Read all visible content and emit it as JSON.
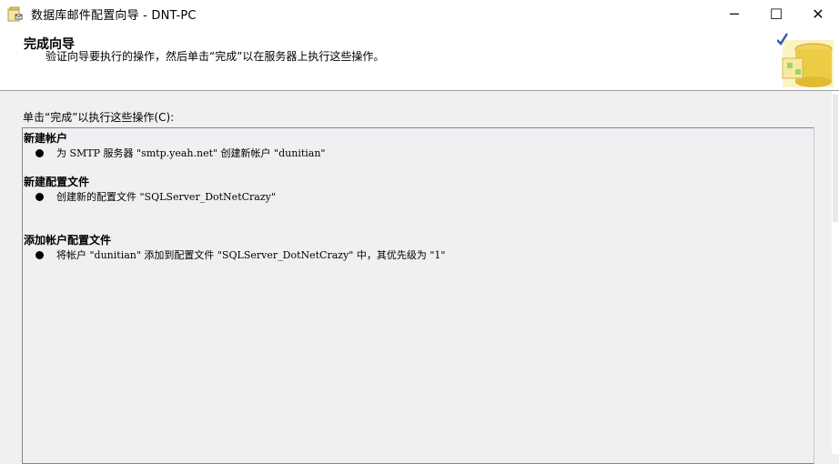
{
  "window": {
    "title": "数据库邮件配置向导 - DNT-PC",
    "minimize_glyph": "─",
    "maximize_glyph": "☐",
    "close_glyph": "✕"
  },
  "header": {
    "title": "完成向导",
    "subtitle": "验证向导要执行的操作，然后单击“完成”以在服务器上执行这些操作。"
  },
  "content": {
    "prompt": "单击“完成”以执行这些操作(C):",
    "sections": [
      {
        "title": "新建帐户",
        "item": "为 SMTP 服务器 \"smtp.yeah.net\" 创建新帐户 \"dunitian\""
      },
      {
        "title": "新建配置文件",
        "item": "创建新的配置文件 \"SQLServer_DotNetCrazy\""
      },
      {
        "title": "添加帐户配置文件",
        "item": "将帐户 \"dunitian\" 添加到配置文件 \"SQLServer_DotNetCrazy\" 中，其优先级为 \"1\""
      }
    ]
  },
  "colors": {
    "window_bg": "#f0f0f0",
    "report_bg": "#f0eff2",
    "check_blue": "#2f5fa8",
    "cylinder_yellow": "#e8c63a"
  },
  "icons": {
    "app": "database-mail-wizard-icon",
    "header": "database-check-icon"
  }
}
